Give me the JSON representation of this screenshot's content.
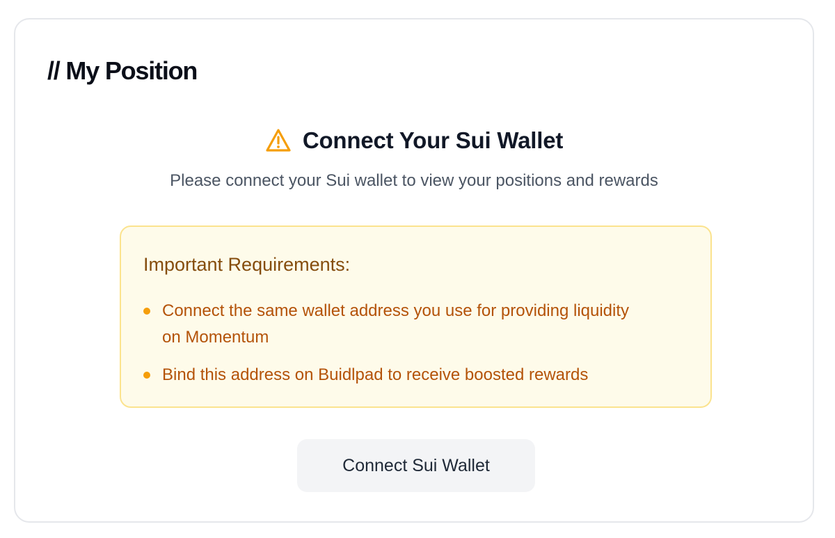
{
  "position": {
    "title": "// My Position"
  },
  "connect_prompt": {
    "icon": "warning-triangle-icon",
    "heading": "Connect Your Sui Wallet",
    "subtitle": "Please connect your Sui wallet to view your positions and rewards"
  },
  "requirements": {
    "title": "Important Requirements:",
    "items": [
      "Connect the same wallet address you use for providing liquidity on Momentum",
      "Bind this address on Buidlpad to receive boosted rewards"
    ]
  },
  "actions": {
    "connect_label": "Connect Sui Wallet"
  },
  "colors": {
    "warning_icon": "#f59e0b",
    "requirements_bg": "#fefbea",
    "requirements_border": "#fbe38e",
    "requirements_text": "#b45309",
    "requirements_title": "#854d0e"
  }
}
